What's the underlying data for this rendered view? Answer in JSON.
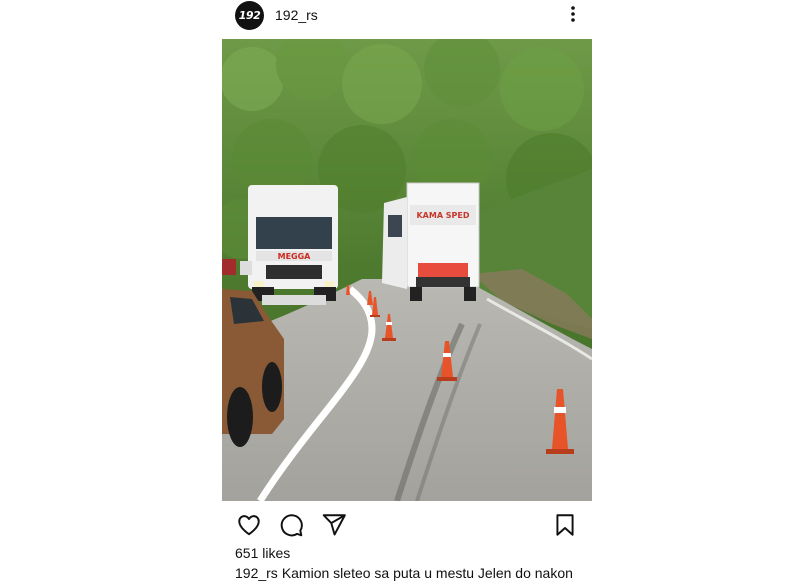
{
  "post": {
    "username": "192_rs",
    "avatar_text": "192",
    "likes": "651 likes",
    "caption_user": "192_rs",
    "caption_text": "Kamion sleteo sa puta u mestu Jelen do nakon"
  },
  "icons": {
    "more": "more-options-icon",
    "like": "heart-icon",
    "comment": "comment-icon",
    "share": "send-icon",
    "save": "bookmark-icon"
  },
  "photo": {
    "truck_left_brand": "MEGGA",
    "truck_right_brand": "KAMA SPED"
  }
}
